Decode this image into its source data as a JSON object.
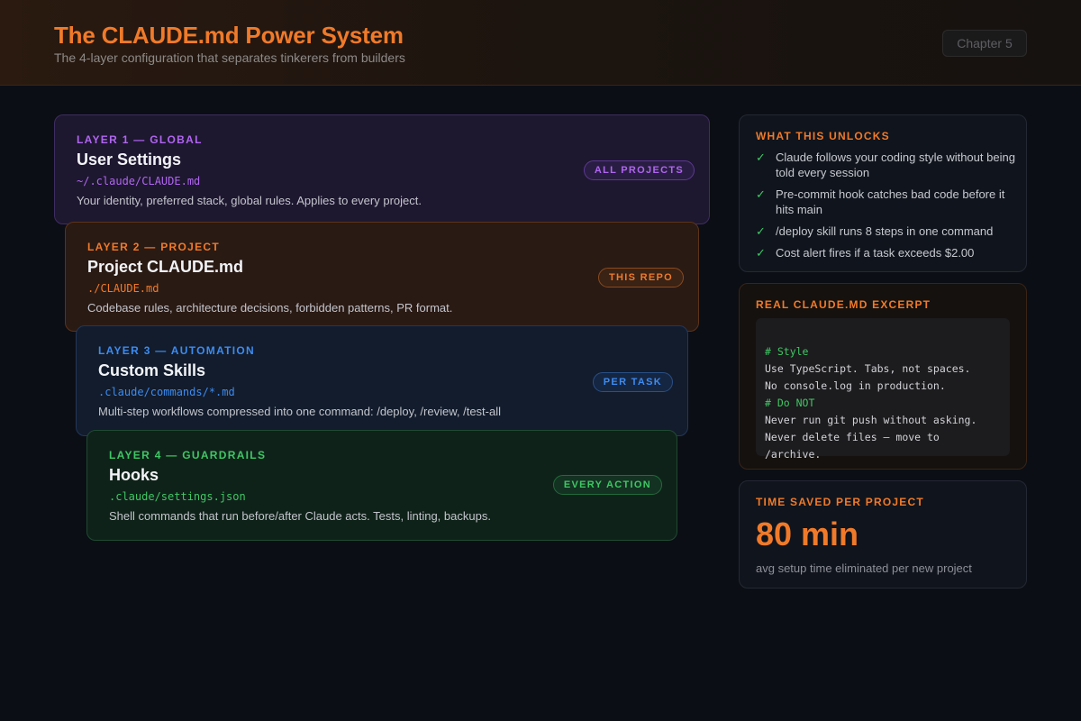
{
  "header": {
    "title": "The CLAUDE.md Power System",
    "subtitle": "The 4-layer configuration that separates tinkerers from builders",
    "chapter": "Chapter 5"
  },
  "layers": [
    {
      "label": "LAYER 1 — GLOBAL",
      "name": "User Settings",
      "path": "~/.claude/CLAUDE.md",
      "description": "Your identity, preferred stack, global rules. Applies to every project.",
      "badge": "ALL PROJECTS",
      "color": "#b066f0"
    },
    {
      "label": "LAYER 2 — PROJECT",
      "name": "Project CLAUDE.md",
      "path": "./CLAUDE.md",
      "description": "Codebase rules, architecture decisions, forbidden patterns, PR format.",
      "badge": "THIS REPO",
      "color": "#f07a2a"
    },
    {
      "label": "LAYER 3 — AUTOMATION",
      "name": "Custom Skills",
      "path": ".claude/commands/*.md",
      "description": "Multi-step workflows compressed into one command: /deploy, /review, /test-all",
      "badge": "PER TASK",
      "color": "#3d8bf0"
    },
    {
      "label": "LAYER 4 — GUARDRAILS",
      "name": "Hooks",
      "path": ".claude/settings.json",
      "description": "Shell commands that run before/after Claude acts. Tests, linting, backups.",
      "badge": "EVERY ACTION",
      "color": "#3fc765"
    }
  ],
  "unlocks": {
    "title": "WHAT THIS UNLOCKS",
    "check_icon": "check-icon",
    "items": [
      "Claude follows your coding style without being told every session",
      "Pre-commit hook catches bad code before it hits main",
      "/deploy skill runs 8 steps in one command",
      "Cost alert fires if a task exceeds $2.00"
    ]
  },
  "excerpt": {
    "title": "REAL CLAUDE.MD EXCERPT",
    "lines": [
      {
        "type": "comment",
        "text": "# Style"
      },
      {
        "type": "text",
        "text": "Use TypeScript. Tabs, not spaces."
      },
      {
        "type": "text",
        "text": "No console.log in production."
      },
      {
        "type": "comment",
        "text": "# Do NOT"
      },
      {
        "type": "text",
        "text": "Never run git push without asking."
      },
      {
        "type": "text",
        "text": "Never delete files — move to"
      },
      {
        "type": "text",
        "text": "/archive."
      }
    ]
  },
  "time_saved": {
    "title": "TIME SAVED PER PROJECT",
    "value": "80 min",
    "caption": "avg setup time eliminated per new project"
  },
  "colors": {
    "accent": "#f07a2a",
    "background": "#0b0e14",
    "check": "#3fc765"
  }
}
